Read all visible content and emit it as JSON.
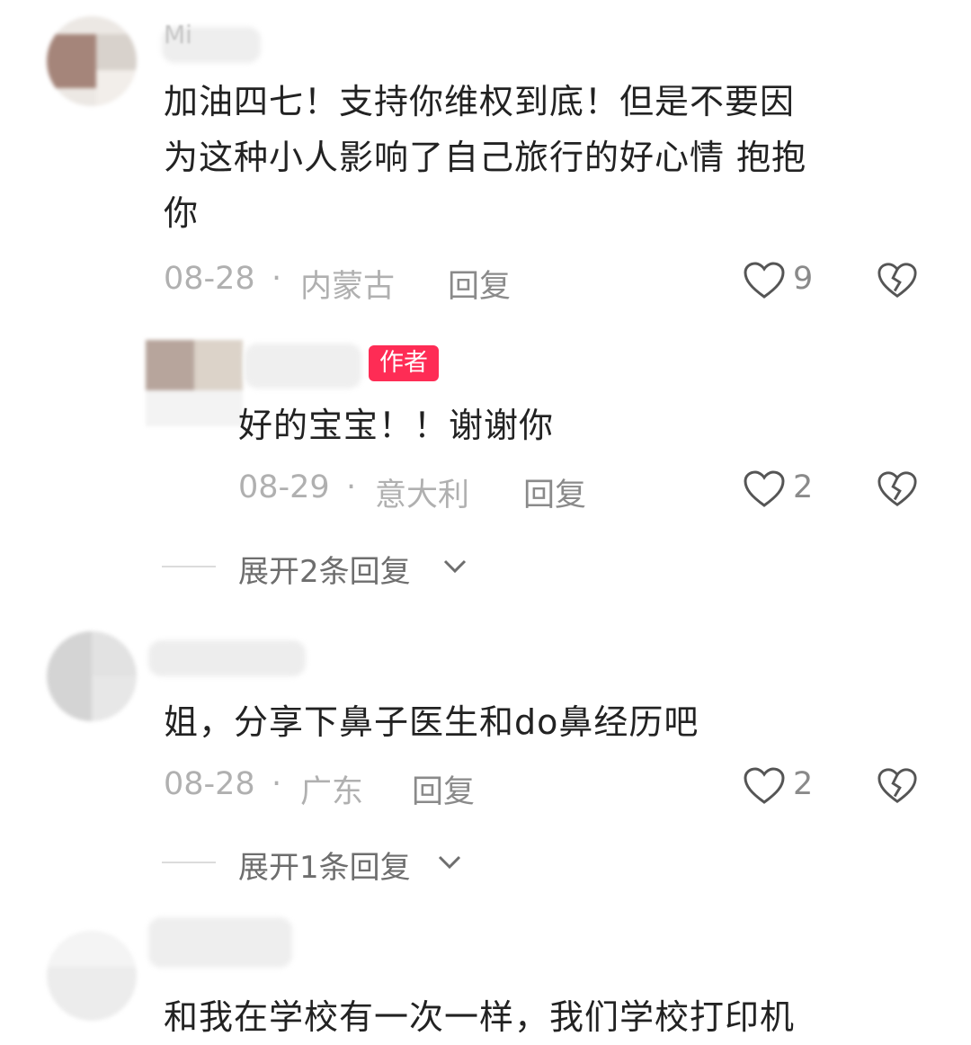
{
  "comments": [
    {
      "username": "Mi",
      "text_lines": [
        "加油四七！支持你维权到底！但是不要因",
        "为这种小人影响了自己旅行的好心情 抱抱",
        "你"
      ],
      "date": "08-28",
      "location": "内蒙古",
      "reply_label": "回复",
      "likes": "9",
      "reply": {
        "badge": "作者",
        "text": "好的宝宝！！谢谢你",
        "date": "08-29",
        "location": "意大利",
        "reply_label": "回复",
        "likes": "2"
      },
      "expand_label": "展开2条回复"
    },
    {
      "text": "姐，分享下鼻子医生和do鼻经历吧",
      "date": "08-28",
      "location": "广东",
      "reply_label": "回复",
      "likes": "2",
      "expand_label": "展开1条回复"
    },
    {
      "text": "和我在学校有一次一样，我们学校打印机"
    }
  ],
  "separator": "·",
  "colors": {
    "author_badge": "#fe2c55",
    "meta": "#b0b0b0",
    "text": "#222222"
  },
  "icons": [
    "heart-outline-icon",
    "broken-heart-icon",
    "chevron-down-icon"
  ]
}
